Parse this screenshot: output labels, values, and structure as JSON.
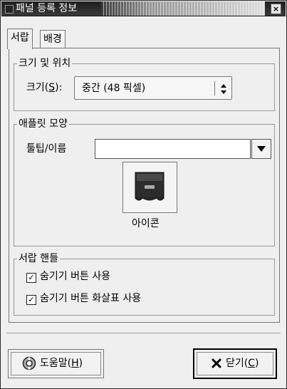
{
  "window": {
    "title": "패널 등록 정보",
    "close_label": "×"
  },
  "tabs": [
    {
      "label": "서랍",
      "active": true
    },
    {
      "label": "배경",
      "active": false
    }
  ],
  "size_section": {
    "title": "크기 및 위치",
    "size_label_prefix": "크기(",
    "size_label_mnemonic": "S",
    "size_label_suffix": "):",
    "size_value": "중간 (48 픽셀)"
  },
  "appearance_section": {
    "title": "애플릿 모양",
    "tooltip_label": "툴팁/이름",
    "tooltip_value": "",
    "icon_caption": "아이콘"
  },
  "drawer_handle_section": {
    "title": "서랍 핸들",
    "checkboxes": [
      {
        "label": "숨기기 버튼 사용",
        "checked": true
      },
      {
        "label": "숨기기 버튼 화살표 사용",
        "checked": true
      }
    ]
  },
  "buttons": {
    "help_prefix": "도움말(",
    "help_mnemonic": "H",
    "help_suffix": ")",
    "close_prefix": "닫기(",
    "close_mnemonic": "C",
    "close_suffix": ")"
  },
  "icons": {
    "help": "lifebuoy-icon",
    "close": "x-icon",
    "drawer": "drawer-icon",
    "spin": "up-down-arrows-icon",
    "dropdown": "triangle-down-icon"
  }
}
